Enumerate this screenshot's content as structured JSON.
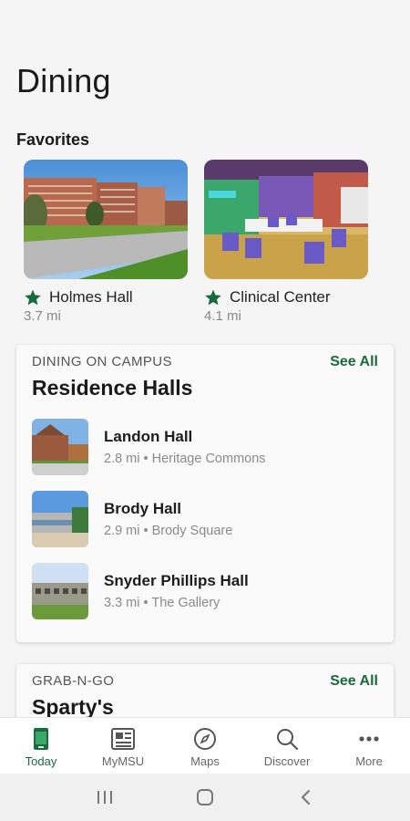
{
  "page": {
    "title": "Dining"
  },
  "favorites": {
    "heading": "Favorites",
    "items": [
      {
        "name": "Holmes Hall",
        "distance": "3.7 mi"
      },
      {
        "name": "Clinical Center",
        "distance": "4.1 mi"
      }
    ]
  },
  "on_campus": {
    "eyebrow": "DINING ON CAMPUS",
    "see_all": "See All",
    "title": "Residence Halls",
    "items": [
      {
        "name": "Landon Hall",
        "subtitle": "2.8 mi • Heritage Commons"
      },
      {
        "name": "Brody Hall",
        "subtitle": "2.9 mi • Brody Square"
      },
      {
        "name": "Snyder Phillips Hall",
        "subtitle": "3.3 mi • The Gallery"
      }
    ]
  },
  "grab_n_go": {
    "eyebrow": "GRAB-N-GO",
    "see_all": "See All",
    "title": "Sparty's"
  },
  "nav": {
    "items": [
      {
        "label": "Today",
        "icon": "phone-icon",
        "active": true
      },
      {
        "label": "MyMSU",
        "icon": "news-icon"
      },
      {
        "label": "Maps",
        "icon": "compass-icon"
      },
      {
        "label": "Discover",
        "icon": "search-icon"
      },
      {
        "label": "More",
        "icon": "more-icon"
      }
    ]
  },
  "colors": {
    "accent": "#1a6b3c",
    "background": "#f5f5f5"
  }
}
